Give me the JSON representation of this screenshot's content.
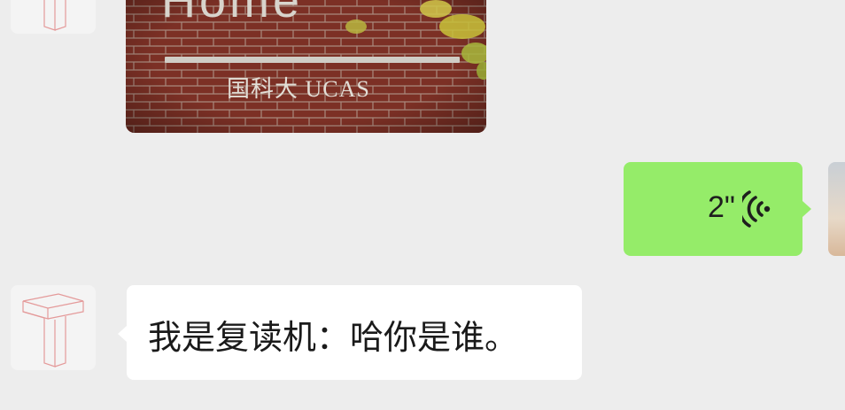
{
  "chat": {
    "messages": [
      {
        "kind": "image",
        "sender": "bot",
        "image": {
          "sign_text_large": "Home",
          "sign_text_small": "国科大 UCAS"
        }
      },
      {
        "kind": "voice",
        "sender": "self",
        "duration": "2\""
      },
      {
        "kind": "text",
        "sender": "bot",
        "text": "我是复读机：哈你是谁。"
      }
    ]
  },
  "colors": {
    "background": "#ededed",
    "sent_bubble": "#95ec69",
    "received_bubble": "#ffffff",
    "avatar_line": "#e49a9a"
  },
  "icons": {
    "voice": "voice-wave-icon",
    "bot_avatar": "letter-t-3d-icon"
  }
}
